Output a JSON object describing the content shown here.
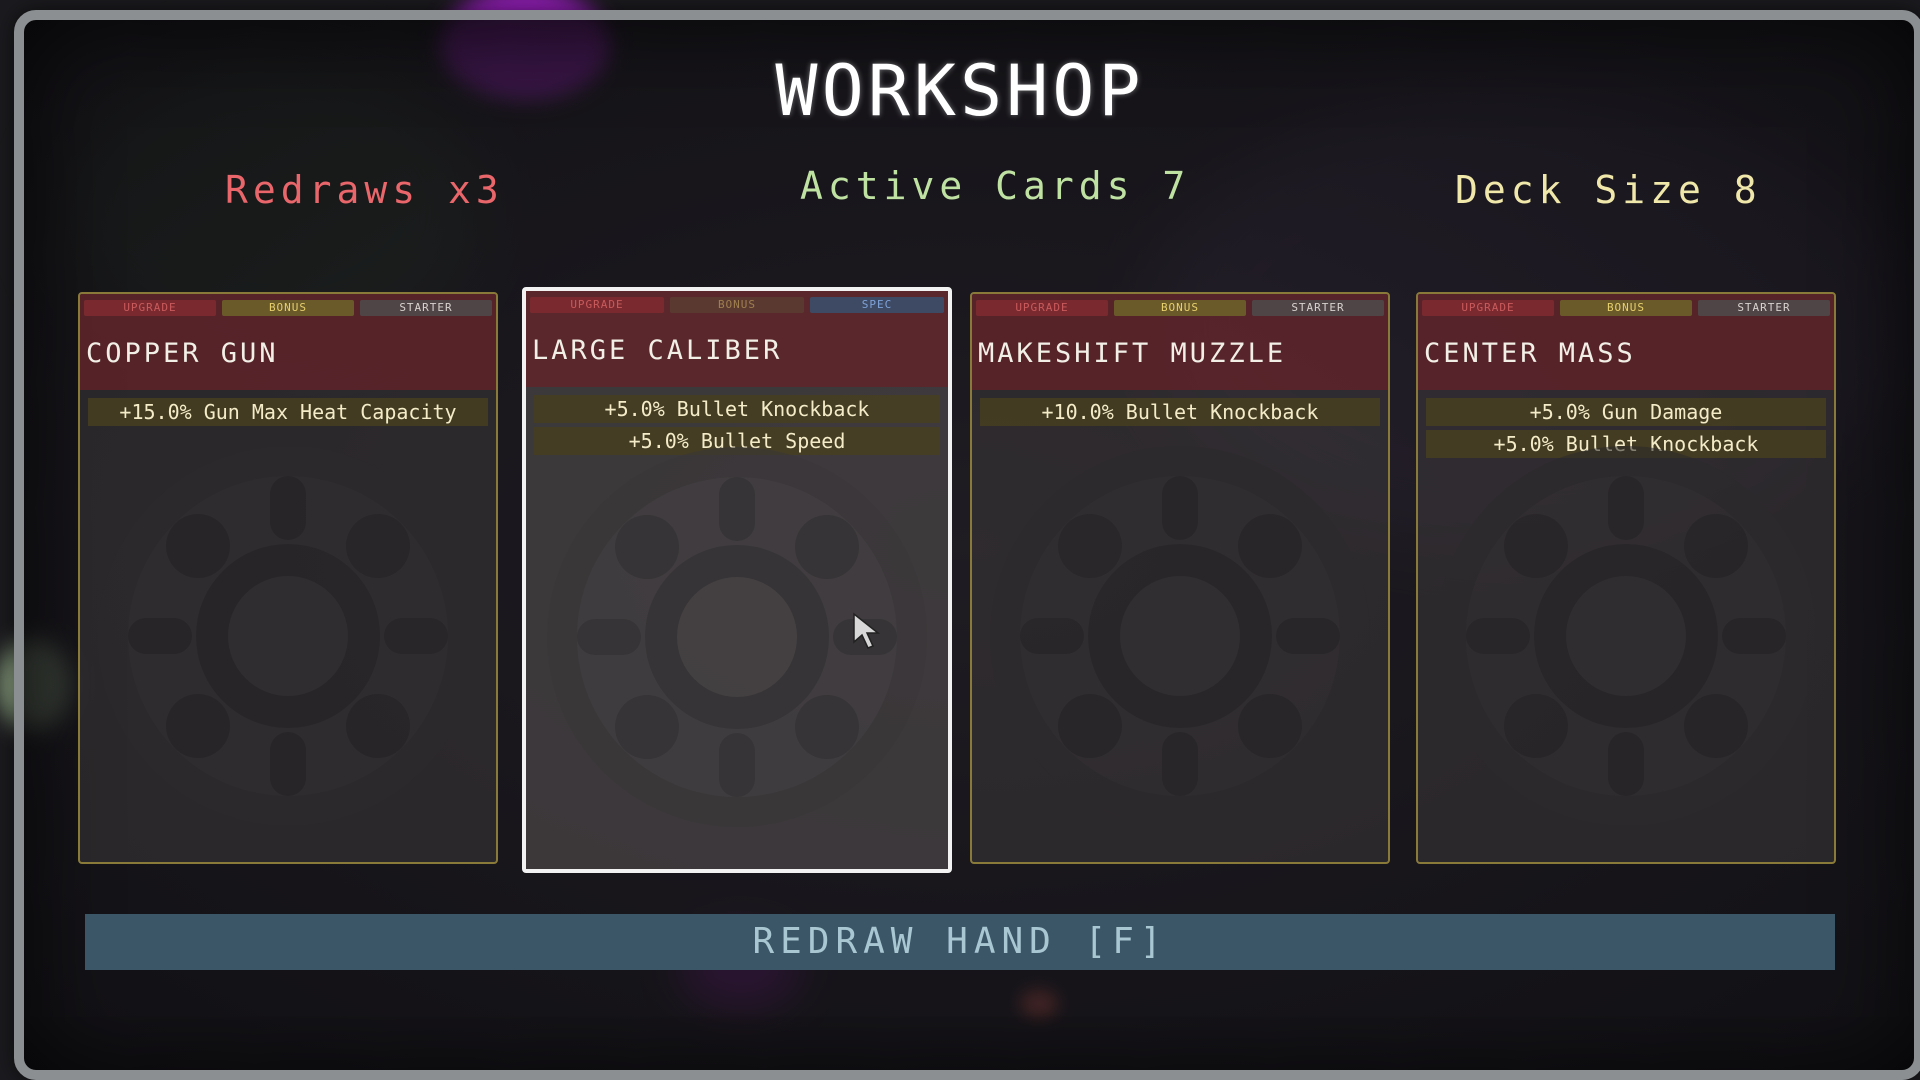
{
  "screen": {
    "title": "WORKSHOP",
    "stats": {
      "redraws": "Redraws x3",
      "active_cards": "Active Cards 7",
      "deck_size": "Deck Size 8"
    },
    "redraw_button_label": "REDRAW HAND [F]"
  },
  "cards": [
    {
      "name": "COPPER GUN",
      "tags": [
        "UPGRADE",
        "BONUS",
        "STARTER"
      ],
      "effects": [
        "+15.0% Gun Max Heat Capacity"
      ],
      "selected": false
    },
    {
      "name": "LARGE CALIBER",
      "tags": [
        "UPGRADE",
        "BONUS",
        "SPEC"
      ],
      "effects": [
        "+5.0% Bullet Knockback",
        "+5.0% Bullet Speed"
      ],
      "selected": true
    },
    {
      "name": "MAKESHIFT MUZZLE",
      "tags": [
        "UPGRADE",
        "BONUS",
        "STARTER"
      ],
      "effects": [
        "+10.0% Bullet Knockback"
      ],
      "selected": false
    },
    {
      "name": "CENTER MASS",
      "tags": [
        "UPGRADE",
        "BONUS",
        "STARTER"
      ],
      "effects": [
        "+5.0% Gun Damage",
        "+5.0% Bullet Knockback"
      ],
      "selected": false
    }
  ],
  "colors": {
    "redraws": "#e9666b",
    "active_cards": "#bfe2a3",
    "deck_size": "#f0e7aa",
    "card_header": "#64222a",
    "effect_bg": "#463e20",
    "redraw_bar": "#3b5666"
  },
  "icons": {
    "card_art": "gear-icon",
    "pointer": "mouse-cursor-icon"
  }
}
